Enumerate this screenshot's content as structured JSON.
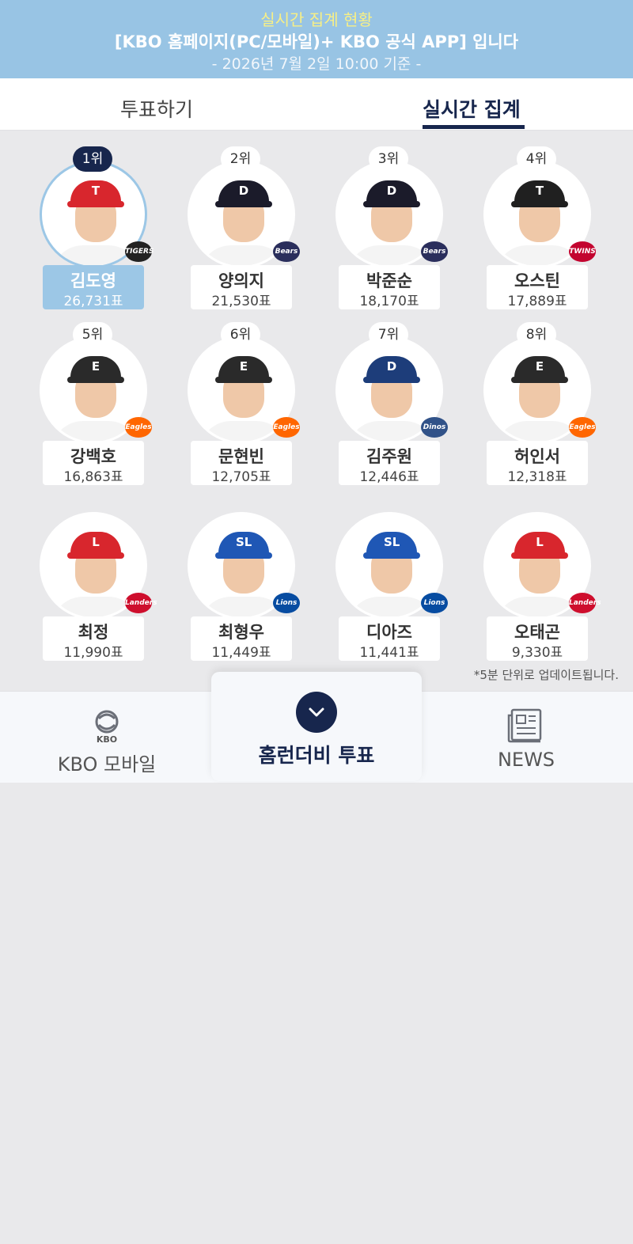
{
  "banner": {
    "line1": "실시간 집계 현황",
    "line2": "[KBO 홈페이지(PC/모바일)+ KBO 공식 APP] 입니다",
    "line3": "- 2026년 7월 2일 10:00 기준 -"
  },
  "tabs": [
    {
      "label": "투표하기",
      "active": false
    },
    {
      "label": "실시간 집계",
      "active": true
    }
  ],
  "players": [
    {
      "rank": "1위",
      "name": "김도영",
      "votes": "26,731표",
      "team": "TIGERS",
      "cap_color": "#d8262d",
      "cap_mark": "T",
      "logo_color": "#222222"
    },
    {
      "rank": "2위",
      "name": "양의지",
      "votes": "21,530표",
      "team": "Bears",
      "cap_color": "#1b1b2a",
      "cap_mark": "D",
      "logo_color": "#2a2e5c"
    },
    {
      "rank": "3위",
      "name": "박준순",
      "votes": "18,170표",
      "team": "Bears",
      "cap_color": "#1b1b2a",
      "cap_mark": "D",
      "logo_color": "#2a2e5c"
    },
    {
      "rank": "4위",
      "name": "오스틴",
      "votes": "17,889표",
      "team": "TWINS",
      "cap_color": "#202020",
      "cap_mark": "T",
      "logo_color": "#c3042f"
    },
    {
      "rank": "5위",
      "name": "강백호",
      "votes": "16,863표",
      "team": "Eagles",
      "cap_color": "#2a2a2a",
      "cap_mark": "E",
      "logo_color": "#ff6600"
    },
    {
      "rank": "6위",
      "name": "문현빈",
      "votes": "12,705표",
      "team": "Eagles",
      "cap_color": "#2a2a2a",
      "cap_mark": "E",
      "logo_color": "#ff6600"
    },
    {
      "rank": "7위",
      "name": "김주원",
      "votes": "12,446표",
      "team": "Dinos",
      "cap_color": "#1d3d7a",
      "cap_mark": "D",
      "logo_color": "#315288"
    },
    {
      "rank": "8위",
      "name": "허인서",
      "votes": "12,318표",
      "team": "Eagles",
      "cap_color": "#2a2a2a",
      "cap_mark": "E",
      "logo_color": "#ff6600"
    },
    {
      "rank": "",
      "name": "최정",
      "votes": "11,990표",
      "team": "Landers",
      "cap_color": "#d8262d",
      "cap_mark": "L",
      "logo_color": "#ce0e2d"
    },
    {
      "rank": "",
      "name": "최형우",
      "votes": "11,449표",
      "team": "Lions",
      "cap_color": "#1f57b5",
      "cap_mark": "SL",
      "logo_color": "#074ca1"
    },
    {
      "rank": "",
      "name": "디아즈",
      "votes": "11,441표",
      "team": "Lions",
      "cap_color": "#1f57b5",
      "cap_mark": "SL",
      "logo_color": "#074ca1"
    },
    {
      "rank": "",
      "name": "오태곤",
      "votes": "9,330표",
      "team": "Landers",
      "cap_color": "#d8262d",
      "cap_mark": "L",
      "logo_color": "#ce0e2d"
    }
  ],
  "note": "*5분 단위로 업데이트됩니다.",
  "bottom_nav": {
    "kbo_logo_text": "KBO",
    "kbo_label": "KBO 모바일",
    "center_label": "홈런더비 투표",
    "news_label": "NEWS"
  },
  "colors": {
    "banner_bg": "#98c4e4",
    "navy": "#17264d",
    "highlight": "#9cc7e6"
  }
}
